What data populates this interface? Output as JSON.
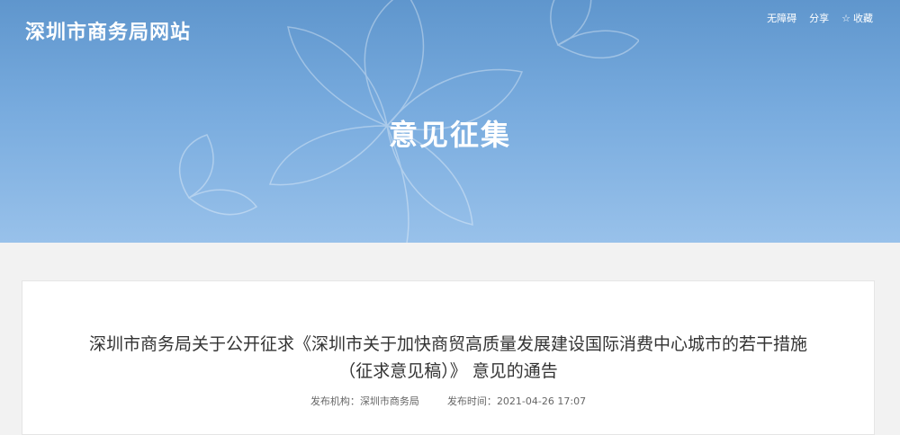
{
  "header": {
    "site_title": "深圳市商务局网站",
    "links": {
      "accessibility": "无障碍",
      "share": "分享",
      "favorite": "收藏"
    }
  },
  "banner": {
    "heading": "意见征集"
  },
  "article": {
    "title": "深圳市商务局关于公开征求《深圳市关于加快商贸高质量发展建设国际消费中心城市的若干措施（征求意见稿）》 意见的通告",
    "meta": {
      "publisher_label": "发布机构：",
      "publisher": "深圳市商务局",
      "time_label": "发布时间：",
      "time": "2021-04-26 17:07"
    }
  },
  "colors": {
    "banner_top": "#5f96cd",
    "banner_bottom": "#98c1ea",
    "page_bg": "#f2f2f2",
    "title_text": "#333333"
  }
}
